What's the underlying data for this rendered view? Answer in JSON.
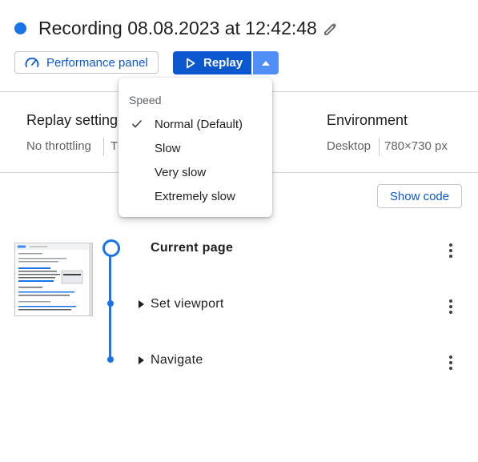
{
  "header": {
    "title": "Recording 08.08.2023 at 12:42:48",
    "performance_label": "Performance panel",
    "replay_label": "Replay",
    "accent_color": "#0b57d0",
    "recording_dot_color": "#1a73e8"
  },
  "replay_settings": {
    "title": "Replay setting",
    "throttling": "No throttling",
    "timeout_partial": "T"
  },
  "environment": {
    "title": "Environment",
    "device": "Desktop",
    "viewport": "780×730 px"
  },
  "speed_menu": {
    "header": "Speed",
    "options": [
      {
        "label": "Normal (Default)",
        "selected": true
      },
      {
        "label": "Slow",
        "selected": false
      },
      {
        "label": "Very slow",
        "selected": false
      },
      {
        "label": "Extremely slow",
        "selected": false
      }
    ]
  },
  "show_code_label": "Show code",
  "steps": [
    {
      "title": "Current page",
      "expandable": false
    },
    {
      "title": "Set viewport",
      "expandable": true
    },
    {
      "title": "Navigate",
      "expandable": true
    }
  ],
  "icons": {
    "edit": "pencil-icon",
    "performance": "gauge-icon",
    "replay": "play-icon",
    "caret": "caret-up-icon",
    "check": "check-icon",
    "more": "more-vertical-icon",
    "expand": "triangle-right-icon"
  }
}
